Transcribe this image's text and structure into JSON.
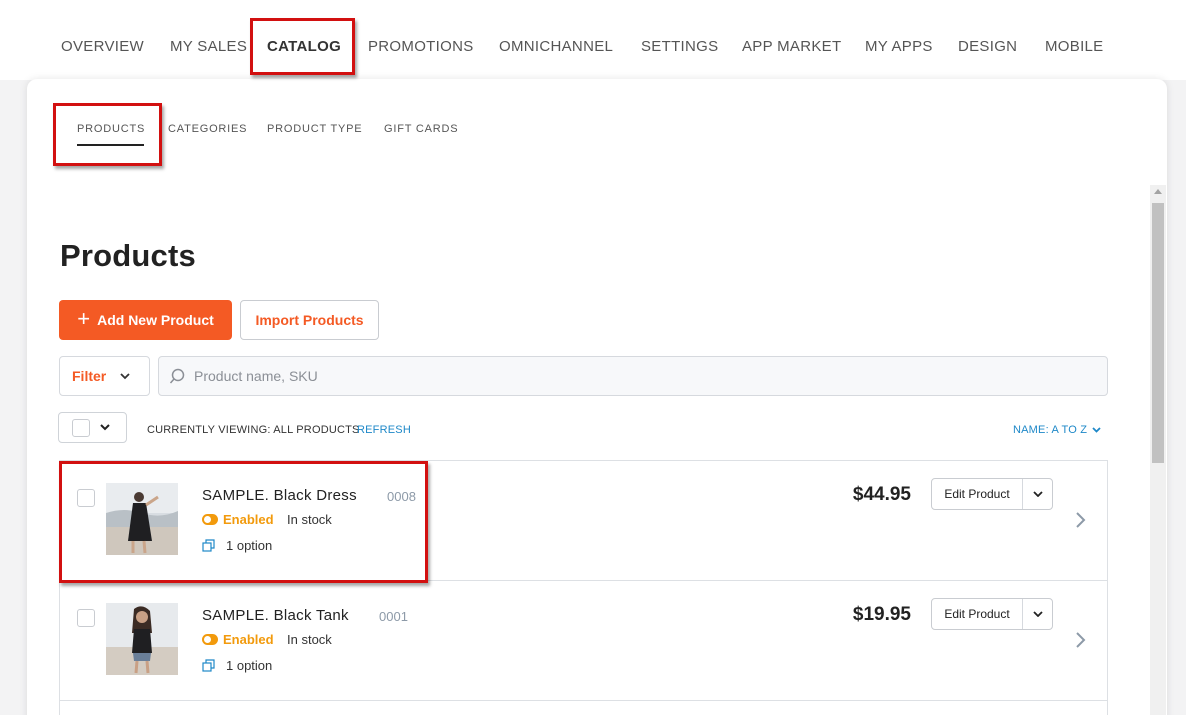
{
  "topnav": {
    "items": [
      "OVERVIEW",
      "MY SALES",
      "CATALOG",
      "PROMOTIONS",
      "OMNICHANNEL",
      "SETTINGS",
      "APP MARKET",
      "MY APPS",
      "DESIGN",
      "MOBILE"
    ]
  },
  "subnav": {
    "items": [
      "PRODUCTS",
      "CATEGORIES",
      "PRODUCT TYPE",
      "GIFT CARDS"
    ]
  },
  "page": {
    "title": "Products",
    "add_button": "Add New Product",
    "import_button": "Import Products",
    "filter_label": "Filter",
    "search_placeholder": "Product name, SKU",
    "viewing_text": "CURRENTLY VIEWING: ALL PRODUCTS",
    "refresh_label": "REFRESH",
    "sort_label": "NAME: A TO Z"
  },
  "products": [
    {
      "name": "SAMPLE. Black Dress",
      "sku": "0008",
      "status": "Enabled",
      "stock": "In stock",
      "options": "1 option",
      "price": "$44.95",
      "edit_label": "Edit Product"
    },
    {
      "name": "SAMPLE. Black Tank",
      "sku": "0001",
      "status": "Enabled",
      "stock": "In stock",
      "options": "1 option",
      "price": "$19.95",
      "edit_label": "Edit Product"
    }
  ],
  "colors": {
    "accent": "#f45a24",
    "link": "#1e88c8",
    "enabled": "#f29a0c",
    "highlight": "#d21010"
  }
}
